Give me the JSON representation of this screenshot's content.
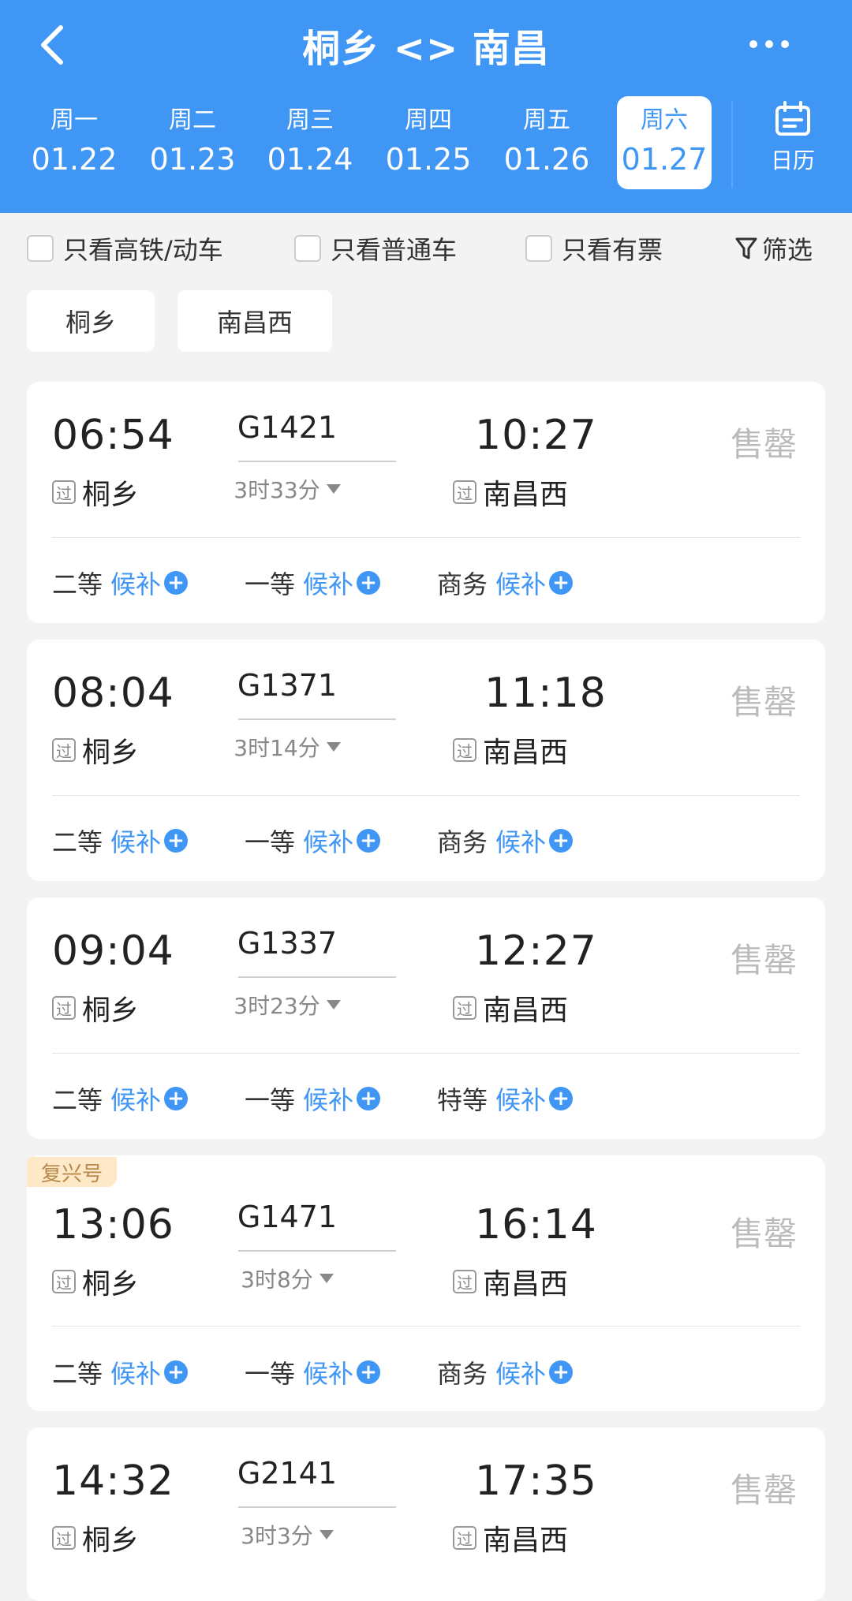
{
  "header": {
    "title": "桐乡 <> 南昌",
    "calendar_label": "日历"
  },
  "dates": [
    {
      "dow": "周一",
      "date": "01.22",
      "active": false
    },
    {
      "dow": "周二",
      "date": "01.23",
      "active": false
    },
    {
      "dow": "周三",
      "date": "01.24",
      "active": false
    },
    {
      "dow": "周四",
      "date": "01.25",
      "active": false
    },
    {
      "dow": "周五",
      "date": "01.26",
      "active": false
    },
    {
      "dow": "周六",
      "date": "01.27",
      "active": true
    }
  ],
  "filters": {
    "high_speed": "只看高铁/动车",
    "ordinary": "只看普通车",
    "available": "只看有票",
    "filter_btn": "筛选"
  },
  "stations": [
    "桐乡",
    "南昌西"
  ],
  "pass_label": "过",
  "soldout_label": "售罄",
  "wait_label": "候补",
  "trains": [
    {
      "dep": "06:54",
      "no": "G1421",
      "dur": "3时33分",
      "arr": "10:27",
      "from": "桐乡",
      "to": "南昌西",
      "seats": [
        "二等",
        "一等",
        "商务"
      ],
      "tag": ""
    },
    {
      "dep": "08:04",
      "no": "G1371",
      "dur": "3时14分",
      "arr": "11:18",
      "from": "桐乡",
      "to": "南昌西",
      "seats": [
        "二等",
        "一等",
        "商务"
      ],
      "tag": ""
    },
    {
      "dep": "09:04",
      "no": "G1337",
      "dur": "3时23分",
      "arr": "12:27",
      "from": "桐乡",
      "to": "南昌西",
      "seats": [
        "二等",
        "一等",
        "特等"
      ],
      "tag": ""
    },
    {
      "dep": "13:06",
      "no": "G1471",
      "dur": "3时8分",
      "arr": "16:14",
      "from": "桐乡",
      "to": "南昌西",
      "seats": [
        "二等",
        "一等",
        "商务"
      ],
      "tag": "复兴号"
    },
    {
      "dep": "14:32",
      "no": "G2141",
      "dur": "3时3分",
      "arr": "17:35",
      "from": "桐乡",
      "to": "南昌西",
      "seats": [],
      "tag": ""
    }
  ],
  "colors": {
    "primary": "#3f96f5",
    "soldout": "#bbbbbb",
    "tag_bg": "#fde9c8"
  }
}
